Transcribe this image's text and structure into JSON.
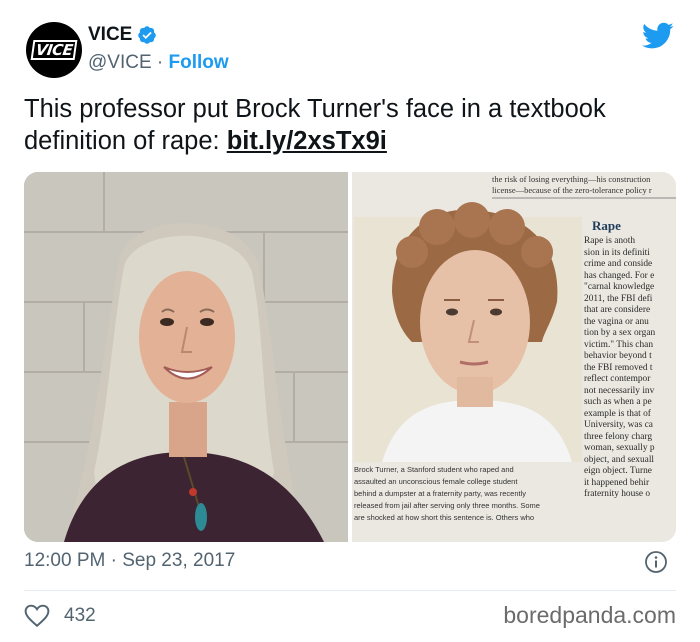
{
  "account": {
    "display_name": "VICE",
    "handle": "@VICE",
    "separator": " · ",
    "follow_label": "Follow",
    "avatar_logo": "VICE",
    "verified": true
  },
  "tweet": {
    "text": "This professor put Brock Turner's face in a textbook definition of rape: ",
    "link_text": "bit.ly/2xsTx9i"
  },
  "textbook": {
    "header_line1": "the risk of losing everything—his construction",
    "header_line2": "license—because of the zero-tolerance policy r",
    "side_label": "Brock Turner, Stanford",
    "section_title": "Rape",
    "body_lines": "Rape is anoth\nsion in its definiti\ncrime and conside\nhas changed. For e\n\"carnal knowledge\n2011, the FBI defi\nthat are considere\nthe vagina or anu\ntion by a sex organ\nvictim.\" This chan\nbehavior beyond t\nthe FBI removed t\nreflect contempor\nnot necessarily inv\nsuch as when a pe\nexample is that of\nUniversity, was ca\nthree felony charg\nwoman, sexually p\nobject, and sexuall\neign object. Turne\nit happened behir\nfraternity house o",
    "caption": "Brock Turner, a Stanford student who raped and\nassaulted an unconscious female college student\nbehind a dumpster at a fraternity party, was recently\nreleased from jail after serving only three months. Some\nare shocked at how short this sentence is. Others who"
  },
  "meta": {
    "time": "12:00 PM",
    "separator": " · ",
    "date": "Sep 23, 2017"
  },
  "footer": {
    "likes": "432",
    "watermark": "boredpanda.com"
  },
  "icons": {
    "twitter_bird": "twitter-bird-icon",
    "verified": "verified-badge-icon",
    "info": "info-icon",
    "heart": "heart-icon"
  },
  "colors": {
    "brand_blue": "#1d9bf0",
    "text_primary": "#0f1419",
    "text_secondary": "#536471"
  }
}
